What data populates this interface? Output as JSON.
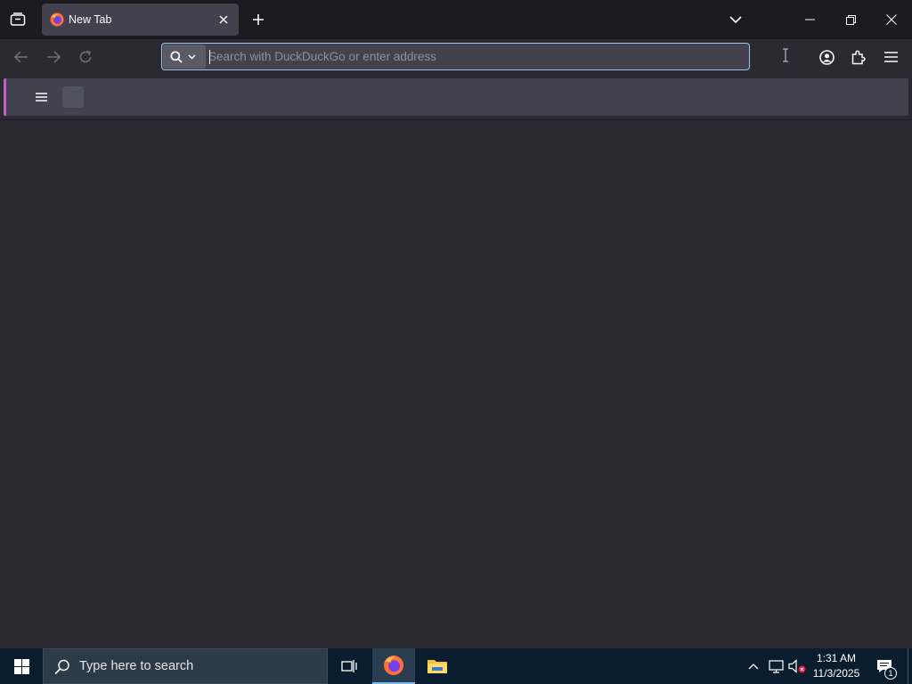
{
  "browser": {
    "tab": {
      "title": "New Tab"
    },
    "urlbar": {
      "placeholder": "Search with DuckDuckGo or enter address",
      "value": ""
    }
  },
  "taskbar": {
    "search_placeholder": "Type here to search",
    "clock": {
      "time": "1:31 AM",
      "date": "11/3/2025"
    },
    "notification_count": "1"
  },
  "icons": {
    "tab_list": "tab-list-icon",
    "firefox": "firefox-icon",
    "close": "close-icon",
    "new_tab": "plus-icon",
    "list_all_tabs": "chevron-down-icon",
    "minimize": "minimize-icon",
    "restore": "restore-icon",
    "back": "back-arrow-icon",
    "forward": "forward-arrow-icon",
    "reload": "reload-icon",
    "search": "search-icon",
    "account": "account-icon",
    "extensions": "puzzle-icon",
    "app_menu": "hamburger-icon",
    "windows": "windows-logo-icon",
    "task_view": "task-view-icon",
    "file_explorer": "folder-icon",
    "network": "network-icon",
    "volume": "volume-muted-icon",
    "notifications": "notification-icon"
  },
  "colors": {
    "accent": "#9bc8e8",
    "titlebar": "#1c1b22",
    "toolbar": "#2b2a33",
    "field": "#42414d",
    "taskbar": "#0a1d2e"
  }
}
